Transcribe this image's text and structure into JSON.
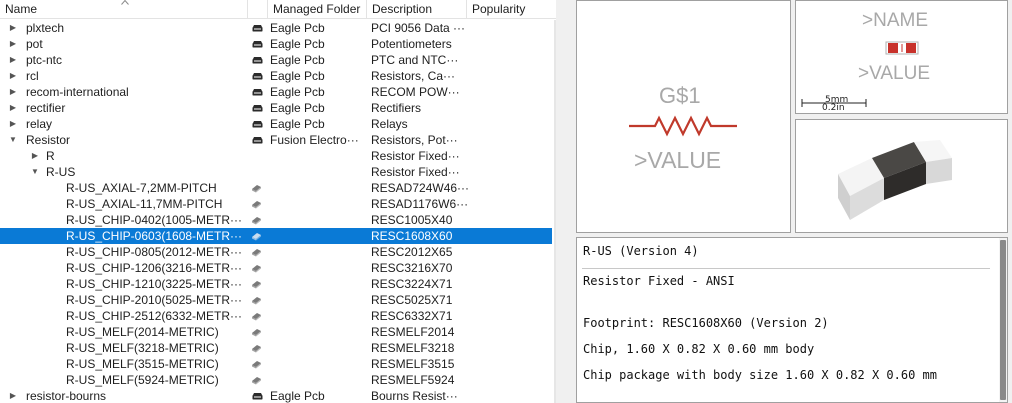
{
  "tree": {
    "columns": {
      "name": "Name",
      "folder": "Managed Folder",
      "description": "Description",
      "popularity": "Popularity"
    },
    "rows": [
      {
        "level": 0,
        "toggle": "▶",
        "name": "plxtech",
        "icon": "library-icon",
        "folder": "Eagle Pcb",
        "description": "PCI 9056 Data ···"
      },
      {
        "level": 0,
        "toggle": "▶",
        "name": "pot",
        "icon": "library-icon",
        "folder": "Eagle Pcb",
        "description": "Potentiometers"
      },
      {
        "level": 0,
        "toggle": "▶",
        "name": "ptc-ntc",
        "icon": "library-icon",
        "folder": "Eagle Pcb",
        "description": "PTC and NTC···"
      },
      {
        "level": 0,
        "toggle": "▶",
        "name": "rcl",
        "icon": "library-icon",
        "folder": "Eagle Pcb",
        "description": "Resistors, Ca···"
      },
      {
        "level": 0,
        "toggle": "▶",
        "name": "recom-international",
        "icon": "library-icon",
        "folder": "Eagle Pcb",
        "description": "RECOM POW···"
      },
      {
        "level": 0,
        "toggle": "▶",
        "name": "rectifier",
        "icon": "library-icon",
        "folder": "Eagle Pcb",
        "description": "Rectifiers"
      },
      {
        "level": 0,
        "toggle": "▶",
        "name": "relay",
        "icon": "library-icon",
        "folder": "Eagle Pcb",
        "description": "Relays"
      },
      {
        "level": 0,
        "toggle": "▼",
        "name": "Resistor",
        "icon": "library-icon",
        "folder": "Fusion Electro···",
        "description": "Resistors, Pot···"
      },
      {
        "level": 1,
        "toggle": "▶",
        "name": "R",
        "icon": "",
        "folder": "",
        "description": "Resistor Fixed···"
      },
      {
        "level": 1,
        "toggle": "▼",
        "name": "R-US",
        "icon": "",
        "folder": "",
        "description": "Resistor Fixed···"
      },
      {
        "level": 2,
        "toggle": "",
        "name": "R-US_AXIAL-7,2MM-PITCH",
        "icon": "device-icon",
        "folder": "",
        "description": "RESAD724W46···"
      },
      {
        "level": 2,
        "toggle": "",
        "name": "R-US_AXIAL-11,7MM-PITCH",
        "icon": "device-icon",
        "folder": "",
        "description": "RESAD1176W6···"
      },
      {
        "level": 2,
        "toggle": "",
        "name": "R-US_CHIP-0402(1005-METR···",
        "icon": "device-icon",
        "folder": "",
        "description": "RESC1005X40"
      },
      {
        "level": 2,
        "toggle": "",
        "name": "R-US_CHIP-0603(1608-METR···",
        "icon": "device-icon",
        "folder": "",
        "description": "RESC1608X60",
        "selected": true
      },
      {
        "level": 2,
        "toggle": "",
        "name": "R-US_CHIP-0805(2012-METR···",
        "icon": "device-icon",
        "folder": "",
        "description": "RESC2012X65"
      },
      {
        "level": 2,
        "toggle": "",
        "name": "R-US_CHIP-1206(3216-METR···",
        "icon": "device-icon",
        "folder": "",
        "description": "RESC3216X70"
      },
      {
        "level": 2,
        "toggle": "",
        "name": "R-US_CHIP-1210(3225-METR···",
        "icon": "device-icon",
        "folder": "",
        "description": "RESC3224X71"
      },
      {
        "level": 2,
        "toggle": "",
        "name": "R-US_CHIP-2010(5025-METR···",
        "icon": "device-icon",
        "folder": "",
        "description": "RESC5025X71"
      },
      {
        "level": 2,
        "toggle": "",
        "name": "R-US_CHIP-2512(6332-METR···",
        "icon": "device-icon",
        "folder": "",
        "description": "RESC6332X71"
      },
      {
        "level": 2,
        "toggle": "",
        "name": "R-US_MELF(2014-METRIC)",
        "icon": "device-icon",
        "folder": "",
        "description": "RESMELF2014"
      },
      {
        "level": 2,
        "toggle": "",
        "name": "R-US_MELF(3218-METRIC)",
        "icon": "device-icon",
        "folder": "",
        "description": "RESMELF3218"
      },
      {
        "level": 2,
        "toggle": "",
        "name": "R-US_MELF(3515-METRIC)",
        "icon": "device-icon",
        "folder": "",
        "description": "RESMELF3515"
      },
      {
        "level": 2,
        "toggle": "",
        "name": "R-US_MELF(5924-METRIC)",
        "icon": "device-icon",
        "folder": "",
        "description": "RESMELF5924"
      },
      {
        "level": 0,
        "toggle": "▶",
        "name": "resistor-bourns",
        "icon": "library-icon",
        "folder": "Eagle Pcb",
        "description": "Bourns Resist···"
      }
    ]
  },
  "schematic": {
    "name": "G$1",
    "value": ">VALUE"
  },
  "symbol": {
    "name": ">NAME",
    "value": ">VALUE",
    "scale_mm": "5mm",
    "scale_in": "0.2in"
  },
  "info": {
    "title": "R-US (Version 4)",
    "description": "Resistor Fixed - ANSI",
    "footprint": "Footprint: RESC1608X60 (Version 2)",
    "body": "Chip, 1.60 X 0.82 X 0.60 mm body",
    "package": "Chip package with body size 1.60 X 0.82 X 0.60 mm"
  },
  "colors": {
    "selection": "#0a7ad6",
    "schematic_text": "#a8a8a8",
    "resistor_symbol": "#c0392b",
    "pad_red": "#c8322b"
  }
}
